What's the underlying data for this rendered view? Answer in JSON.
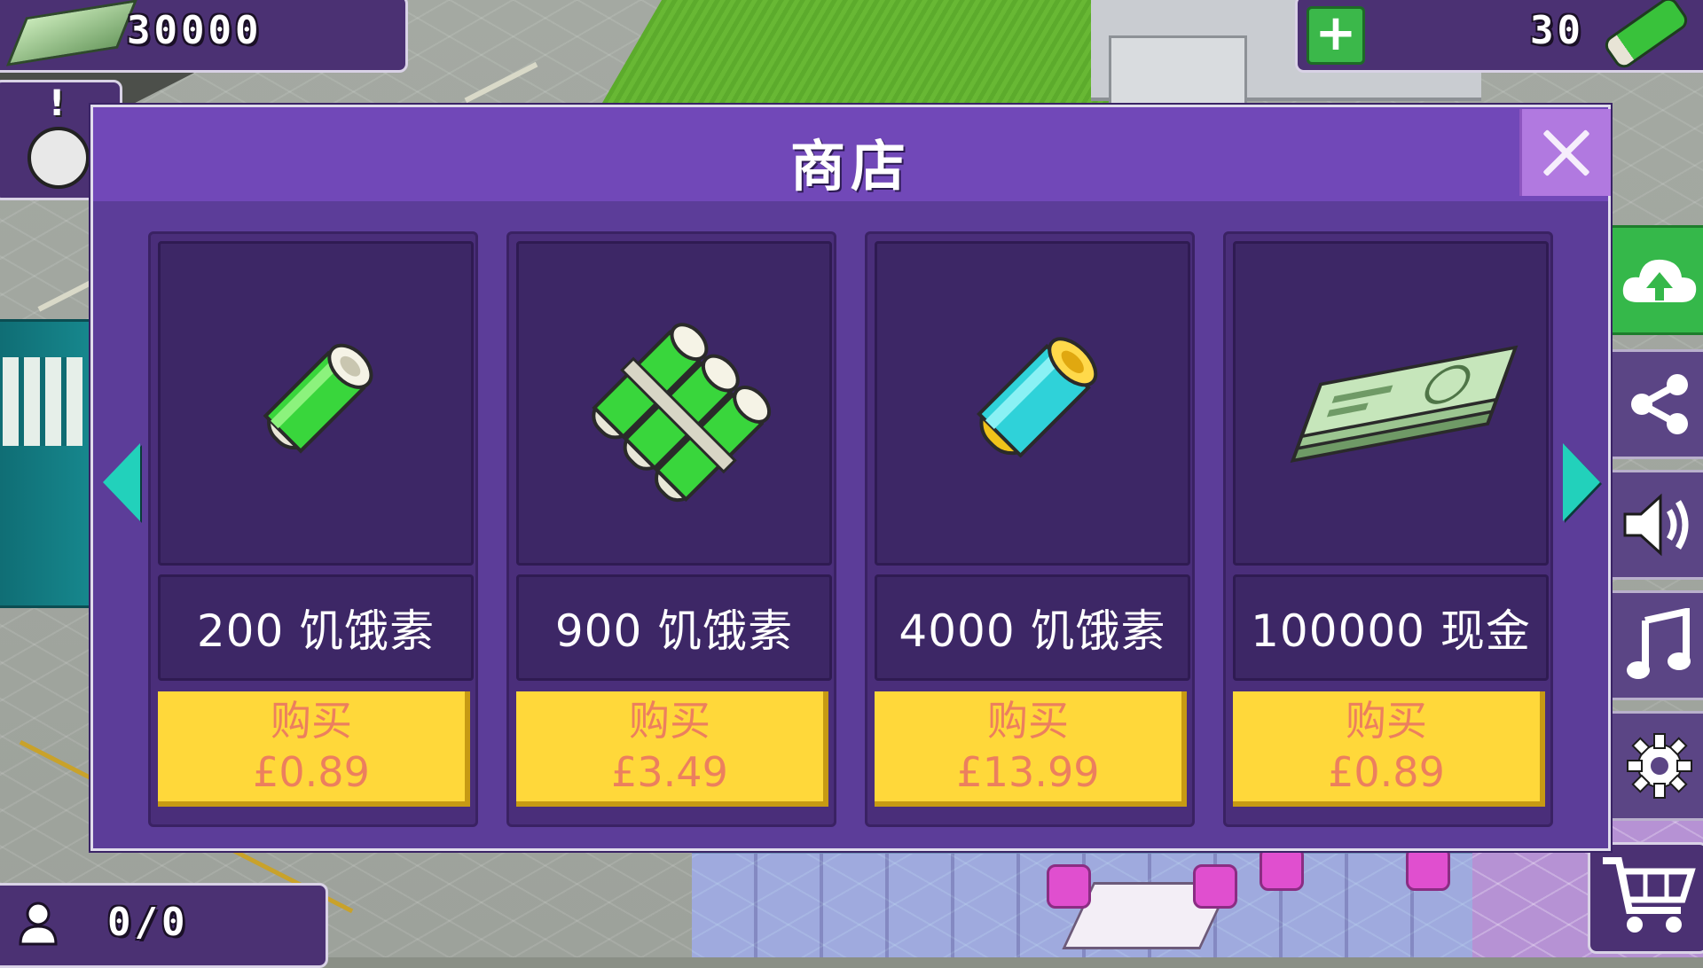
{
  "hud": {
    "money": "30000",
    "energy": "30",
    "population": "0/0"
  },
  "shop": {
    "title": "商店",
    "products": [
      {
        "name": "200 饥饿素",
        "buy_label": "购买",
        "price": "£0.89",
        "icon": "single-green-battery-icon"
      },
      {
        "name": "900 饥饿素",
        "buy_label": "购买",
        "price": "£3.49",
        "icon": "green-battery-bundle-icon"
      },
      {
        "name": "4000 饥饿素",
        "buy_label": "购买",
        "price": "£13.99",
        "icon": "cyan-battery-icon"
      },
      {
        "name": "100000 现金",
        "buy_label": "购买",
        "price": "£0.89",
        "icon": "cash-stack-icon"
      }
    ]
  },
  "colors": {
    "panel": "#5c3d99",
    "header": "#7148b8",
    "buy_button": "#ffd83a",
    "buy_text": "#ec7f5e",
    "arrow": "#22d1bb"
  }
}
